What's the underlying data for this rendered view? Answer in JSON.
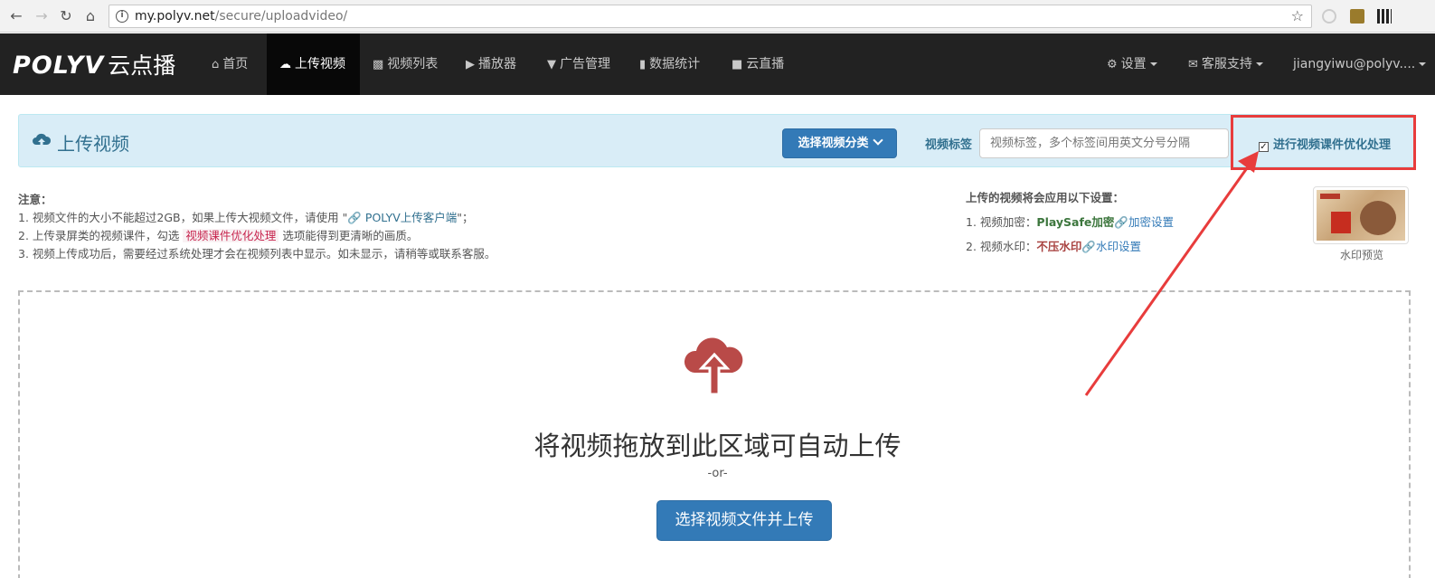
{
  "browser": {
    "url_host": "my.polyv.net",
    "url_path": "/secure/uploadvideo/",
    "info_glyph": "i"
  },
  "logo": {
    "brand": "POLYV",
    "suffix": "云点播"
  },
  "nav": {
    "items": [
      {
        "label": "首页",
        "icon": "home-icon"
      },
      {
        "label": "上传视频",
        "icon": "cloud-upload-icon",
        "active": true
      },
      {
        "label": "视频列表",
        "icon": "film-icon"
      },
      {
        "label": "播放器",
        "icon": "play-circle-icon"
      },
      {
        "label": "广告管理",
        "icon": "filter-icon"
      },
      {
        "label": "数据统计",
        "icon": "bar-chart-icon"
      },
      {
        "label": "云直播",
        "icon": "video-camera-icon"
      }
    ],
    "settings": "设置",
    "support": "客服支持",
    "user": "jiangyiwu@polyv...."
  },
  "panel": {
    "title": "上传视频",
    "category_button": "选择视频分类",
    "tag_label": "视频标签",
    "tag_placeholder": "视频标签，多个标签间用英文分号分隔",
    "optimize_label": "进行视频课件优化处理",
    "optimize_checked": true
  },
  "notes": {
    "heading": "注意：",
    "line1_pre": "1. 视频文件的大小不能超过2GB，如果上传大视频文件，请使用 \"",
    "line1_link": "POLYV上传客户端",
    "line1_post": "\"；",
    "line2_pre": "2. 上传录屏类的视频课件，勾选",
    "line2_code": "视频课件优化处理",
    "line2_post": "选项能得到更清晰的画质。",
    "line3": "3. 视频上传成功后，需要经过系统处理才会在视频列表中显示。如未显示，请稍等或联系客服。"
  },
  "settings": {
    "heading": "上传的视频将会应用以下设置：",
    "encrypt_label": "1. 视频加密：",
    "encrypt_value": "PlaySafe加密",
    "encrypt_link": "加密设置",
    "watermark_label": "2. 视频水印：",
    "watermark_value": "不压水印",
    "watermark_link": "水印设置",
    "preview_caption": "水印预览"
  },
  "dropzone": {
    "title": "将视频拖放到此区域可自动上传",
    "or": "-or-",
    "button": "选择视频文件并上传"
  },
  "colors": {
    "nav_bg": "#222222",
    "primary": "#337ab7",
    "info_bg": "#d9edf7",
    "cloud": "#b94a48",
    "annotation": "#e83c3c"
  }
}
